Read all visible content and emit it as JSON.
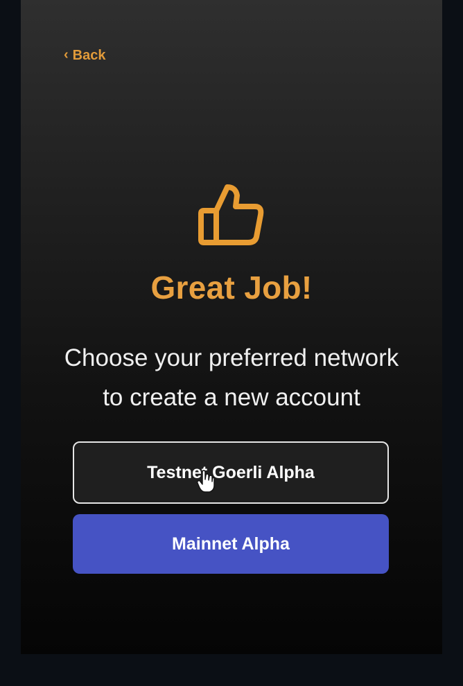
{
  "colors": {
    "accent": "#e29b3a",
    "title": "#e8a040",
    "primary_button": "#4653c4",
    "outline_button_border": "#e6e6e6"
  },
  "nav": {
    "back_icon": "chevron-left-icon",
    "back_label": "Back"
  },
  "hero": {
    "icon": "thumbs-up-icon",
    "title": "Great Job!",
    "subtitle_line1": "Choose your preferred network",
    "subtitle_line2": "to create a new account"
  },
  "networks": {
    "testnet_label": "Testnet Goerli Alpha",
    "mainnet_label": "Mainnet Alpha"
  }
}
